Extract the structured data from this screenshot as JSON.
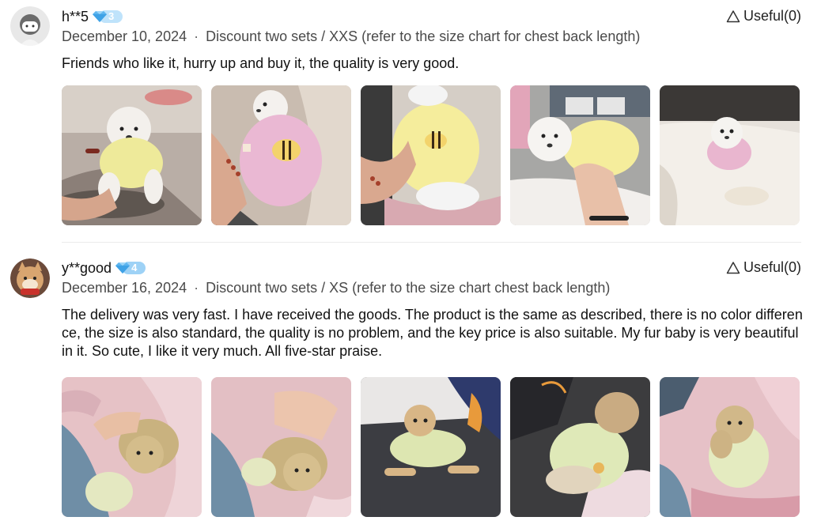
{
  "reviews": [
    {
      "username": "h**5",
      "vip_level": "3",
      "useful_label": "Useful(0)",
      "date": "December 10, 2024",
      "separator": "·",
      "variant": "Discount two sets / XXS (refer to the size chart for chest back length)",
      "text": "Friends who like it, hurry up and buy it, the quality is very good.",
      "photos": [
        {
          "icon": "puppy-yellow-sweater-photo"
        },
        {
          "icon": "puppy-pink-bee-sweater-photo"
        },
        {
          "icon": "yellow-bee-sweater-photo"
        },
        {
          "icon": "puppy-yellow-sweater-held-photo"
        },
        {
          "icon": "puppy-pink-sweater-photo"
        }
      ]
    },
    {
      "username": "y**good",
      "vip_level": "4",
      "useful_label": "Useful(0)",
      "date": "December 16, 2024",
      "separator": "·",
      "variant": "Discount two sets / XS (refer to the size chart chest back length)",
      "text": "The delivery was very fast. I have received the goods. The product is the same as described, there is no color difference, the size is also standard, the quality is no problem, and the key price is also suitable. My fur baby is very beautiful in it. So cute, I like it very much. All five-star praise.",
      "photos": [
        {
          "icon": "kitten-green-sweater-photo"
        },
        {
          "icon": "kitten-green-sweater-photo-2"
        },
        {
          "icon": "kitten-lying-green-sweater-photo"
        },
        {
          "icon": "kitten-back-green-sweater-photo"
        },
        {
          "icon": "kitten-held-green-sweater-photo"
        }
      ]
    }
  ],
  "colors": {
    "text": "#111111",
    "meta": "#4a4a4a",
    "badge": "#7cc4f2",
    "divider": "#ececec"
  }
}
